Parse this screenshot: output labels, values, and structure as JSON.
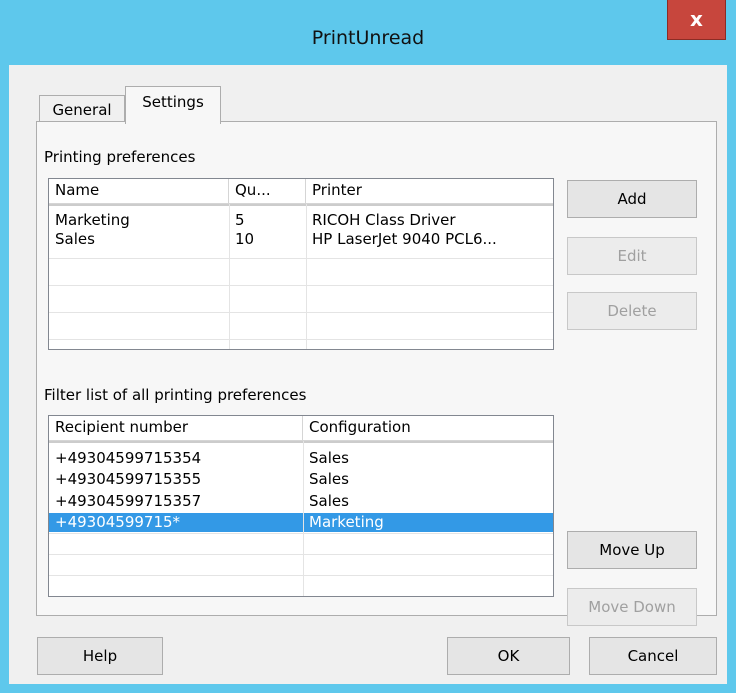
{
  "window": {
    "title": "PrintUnread",
    "close_glyph": "x"
  },
  "tabs": [
    {
      "label": "General",
      "selected": false
    },
    {
      "label": "Settings",
      "selected": true
    }
  ],
  "printing": {
    "label": "Printing preferences",
    "columns": [
      "Name",
      "Qu...",
      "Printer"
    ],
    "rows": [
      {
        "name": "Marketing",
        "quantity": "5",
        "printer": "RICOH Class Driver"
      },
      {
        "name": "Sales",
        "quantity": "10",
        "printer": "HP LaserJet 9040 PCL6..."
      }
    ],
    "buttons": {
      "add": "Add",
      "edit": "Edit",
      "delete": "Delete"
    }
  },
  "filter": {
    "label": "Filter list of all printing preferences",
    "columns": [
      "Recipient number",
      "Configuration"
    ],
    "rows": [
      {
        "recipient": "+49304599715354",
        "configuration": "Sales"
      },
      {
        "recipient": "+49304599715355",
        "configuration": "Sales"
      },
      {
        "recipient": "+49304599715357",
        "configuration": "Sales"
      },
      {
        "recipient": "+49304599715*",
        "configuration": "Marketing",
        "selected": true
      }
    ],
    "buttons": {
      "move_up": "Move Up",
      "move_down": "Move Down"
    }
  },
  "footer": {
    "help": "Help",
    "ok": "OK",
    "cancel": "Cancel"
  },
  "colors": {
    "frame": "#5ec8ec",
    "close": "#c7463d",
    "selection": "#3399e6",
    "dialog": "#f0f0f0"
  }
}
